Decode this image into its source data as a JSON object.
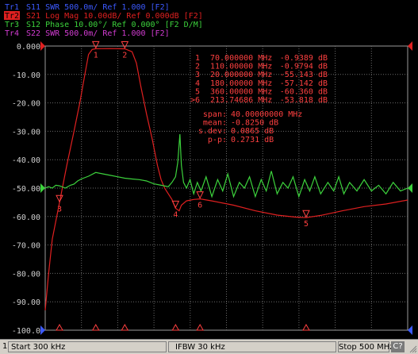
{
  "chart_data": {
    "type": "line",
    "trace_headers": [
      {
        "label": "Tr1",
        "text": "S11 SWR 500.0m/ Ref 1.000 [F2]",
        "color": "#3c5aff",
        "active": false
      },
      {
        "label": "Tr2",
        "text": "S21 Log Mag 10.00dB/ Ref 0.000dB [F2]",
        "color": "#e02020",
        "active": true
      },
      {
        "label": "Tr3",
        "text": "S12 Phase 10.00°/ Ref 0.000° [F2 D/M]",
        "color": "#3cd23c",
        "active": false
      },
      {
        "label": "Tr4",
        "text": "S22 SWR 500.0m/ Ref 1.000 [F2]",
        "color": "#d23cd2",
        "active": false
      }
    ],
    "y_ticks": [
      "0.000",
      "-10.00",
      "-20.00",
      "-30.00",
      "-40.00",
      "-50.00",
      "-60.00",
      "-70.00",
      "-80.00",
      "-90.00",
      "-100.0"
    ],
    "ylim": [
      -100,
      0
    ],
    "xlim": [
      0.3,
      500
    ],
    "x_unit": "MHz",
    "markers": [
      {
        "id": "1",
        "freq": "70.000000 MHz",
        "value": "-0.9389 dB",
        "x": 70,
        "y": -0.94
      },
      {
        "id": "2",
        "freq": "110.00000 MHz",
        "value": "-0.9794 dB",
        "x": 110,
        "y": -0.98
      },
      {
        "id": "3",
        "freq": "20.000000 MHz",
        "value": "-55.143 dB",
        "x": 20,
        "y": -55.1
      },
      {
        "id": "4",
        "freq": "180.00000 MHz",
        "value": "-57.142 dB",
        "x": 180,
        "y": -57.1
      },
      {
        "id": "5",
        "freq": "360.00000 MHz",
        "value": "-60.360 dB",
        "x": 360,
        "y": -60.4
      },
      {
        "id": ">6",
        "freq": "213.74686 MHz",
        "value": "-53.818 dB",
        "x": 213.7,
        "y": -53.8
      }
    ],
    "stats": [
      {
        "label": "span:",
        "value": "40.00000000 MHz"
      },
      {
        "label": "mean:",
        "value": "-0.8250 dB"
      },
      {
        "label": "s.dev:",
        "value": "0.0865 dB"
      },
      {
        "label": "p-p:",
        "value": "0.2731 dB"
      }
    ],
    "series": [
      {
        "name": "Tr2",
        "color": "#e02020",
        "points": [
          [
            0.3,
            -93
          ],
          [
            5,
            -80
          ],
          [
            10,
            -68
          ],
          [
            20,
            -55.1
          ],
          [
            30,
            -42
          ],
          [
            40,
            -30
          ],
          [
            48,
            -20
          ],
          [
            55,
            -10
          ],
          [
            60,
            -3
          ],
          [
            65,
            -1.2
          ],
          [
            70,
            -0.94
          ],
          [
            90,
            -0.9
          ],
          [
            110,
            -0.98
          ],
          [
            120,
            -2
          ],
          [
            126,
            -6
          ],
          [
            132,
            -14
          ],
          [
            140,
            -24
          ],
          [
            148,
            -33
          ],
          [
            155,
            -42
          ],
          [
            160,
            -47
          ],
          [
            165,
            -50
          ],
          [
            170,
            -52
          ],
          [
            175,
            -54
          ],
          [
            180,
            -57.1
          ],
          [
            185,
            -58
          ],
          [
            188,
            -56
          ],
          [
            195,
            -54.5
          ],
          [
            205,
            -54
          ],
          [
            213.7,
            -53.8
          ],
          [
            230,
            -54.5
          ],
          [
            260,
            -56
          ],
          [
            290,
            -58
          ],
          [
            320,
            -59.5
          ],
          [
            345,
            -60.2
          ],
          [
            360,
            -60.4
          ],
          [
            380,
            -59.6
          ],
          [
            410,
            -58
          ],
          [
            440,
            -56.5
          ],
          [
            470,
            -55.6
          ],
          [
            500,
            -54.2
          ]
        ]
      },
      {
        "name": "Tr3",
        "color": "#3cd23c",
        "points": [
          [
            0.3,
            -50
          ],
          [
            5,
            -49.5
          ],
          [
            10,
            -50
          ],
          [
            15,
            -49
          ],
          [
            20,
            -49.2
          ],
          [
            28,
            -50
          ],
          [
            35,
            -49
          ],
          [
            40,
            -48.6
          ],
          [
            45,
            -47.5
          ],
          [
            50,
            -46.8
          ],
          [
            60,
            -45.8
          ],
          [
            70,
            -44.5
          ],
          [
            80,
            -45
          ],
          [
            90,
            -45.5
          ],
          [
            100,
            -46
          ],
          [
            110,
            -46.5
          ],
          [
            120,
            -46.8
          ],
          [
            130,
            -47
          ],
          [
            140,
            -47.5
          ],
          [
            150,
            -48.5
          ],
          [
            160,
            -49
          ],
          [
            170,
            -49.5
          ],
          [
            175,
            -48
          ],
          [
            180,
            -46
          ],
          [
            183,
            -41
          ],
          [
            186,
            -31
          ],
          [
            188,
            -42
          ],
          [
            191,
            -48
          ],
          [
            195,
            -50
          ],
          [
            200,
            -47
          ],
          [
            205,
            -52
          ],
          [
            210,
            -48
          ],
          [
            215,
            -51
          ],
          [
            222,
            -46
          ],
          [
            230,
            -53
          ],
          [
            238,
            -47
          ],
          [
            245,
            -51
          ],
          [
            252,
            -45
          ],
          [
            260,
            -53
          ],
          [
            268,
            -48
          ],
          [
            275,
            -50
          ],
          [
            282,
            -46
          ],
          [
            290,
            -53
          ],
          [
            298,
            -47
          ],
          [
            305,
            -51
          ],
          [
            312,
            -44
          ],
          [
            320,
            -52
          ],
          [
            328,
            -48
          ],
          [
            335,
            -50
          ],
          [
            342,
            -46
          ],
          [
            350,
            -53
          ],
          [
            358,
            -47
          ],
          [
            365,
            -51
          ],
          [
            372,
            -46
          ],
          [
            380,
            -52
          ],
          [
            390,
            -48
          ],
          [
            398,
            -51
          ],
          [
            405,
            -46
          ],
          [
            412,
            -52
          ],
          [
            420,
            -48
          ],
          [
            430,
            -51
          ],
          [
            440,
            -47
          ],
          [
            450,
            -51
          ],
          [
            460,
            -49
          ],
          [
            470,
            -52
          ],
          [
            480,
            -48
          ],
          [
            490,
            -51
          ],
          [
            500,
            -50
          ]
        ]
      }
    ]
  },
  "statusbar": {
    "channel": "1",
    "start": "Start 300 kHz",
    "ifbw": "IFBW 30 kHz",
    "stop": "Stop 500 MHz",
    "badge": "C?"
  }
}
